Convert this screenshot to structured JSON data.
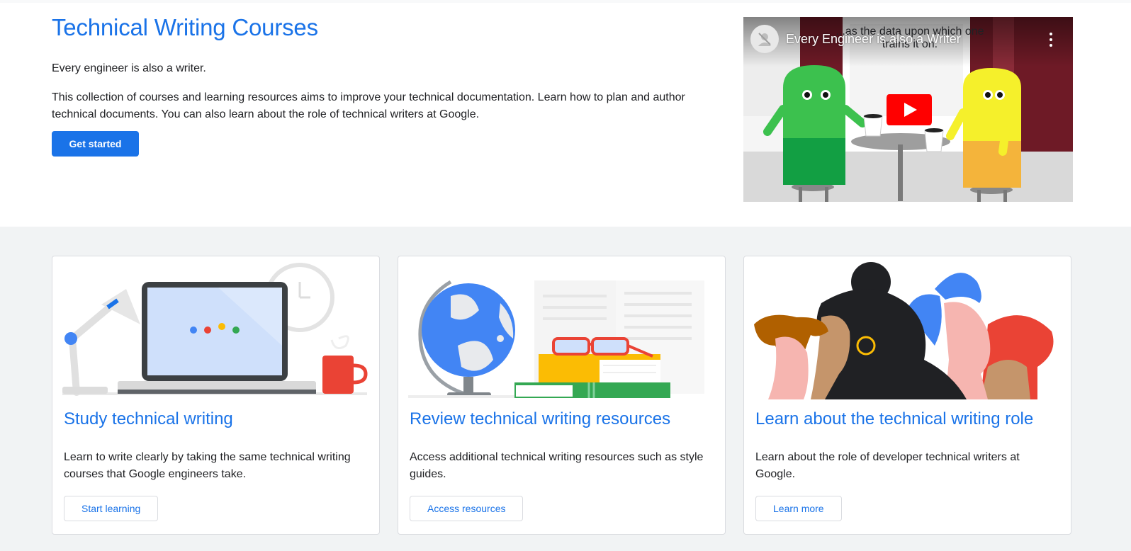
{
  "hero": {
    "title": "Technical Writing Courses",
    "tagline": "Every engineer is also a writer.",
    "description": "This collection of courses and learning resources aims to improve your technical documentation. Learn how to plan and author technical documents. You can also learn about the role of technical writers at Google.",
    "cta_label": "Get started"
  },
  "video": {
    "title": "Every Engineer is also a Writer",
    "caption": "...as the data upon which one trains it on.",
    "play_icon": "play-icon",
    "menu_icon": "more-vert-icon"
  },
  "cards": [
    {
      "title": "Study technical writing",
      "description": "Learn to write clearly by taking the same technical writing courses that Google engineers take.",
      "button_label": "Start learning",
      "illustration": "laptop-desk-illustration"
    },
    {
      "title": "Review technical writing resources",
      "description": "Access additional technical writing resources such as style guides.",
      "button_label": "Access resources",
      "illustration": "globe-books-illustration"
    },
    {
      "title": "Learn about the technical writing role",
      "description": "Learn about the role of developer technical writers at Google.",
      "button_label": "Learn more",
      "illustration": "people-profiles-illustration"
    }
  ],
  "colors": {
    "accent": "#1a73e8",
    "section_bg": "#f1f3f4",
    "border": "#dadce0"
  }
}
